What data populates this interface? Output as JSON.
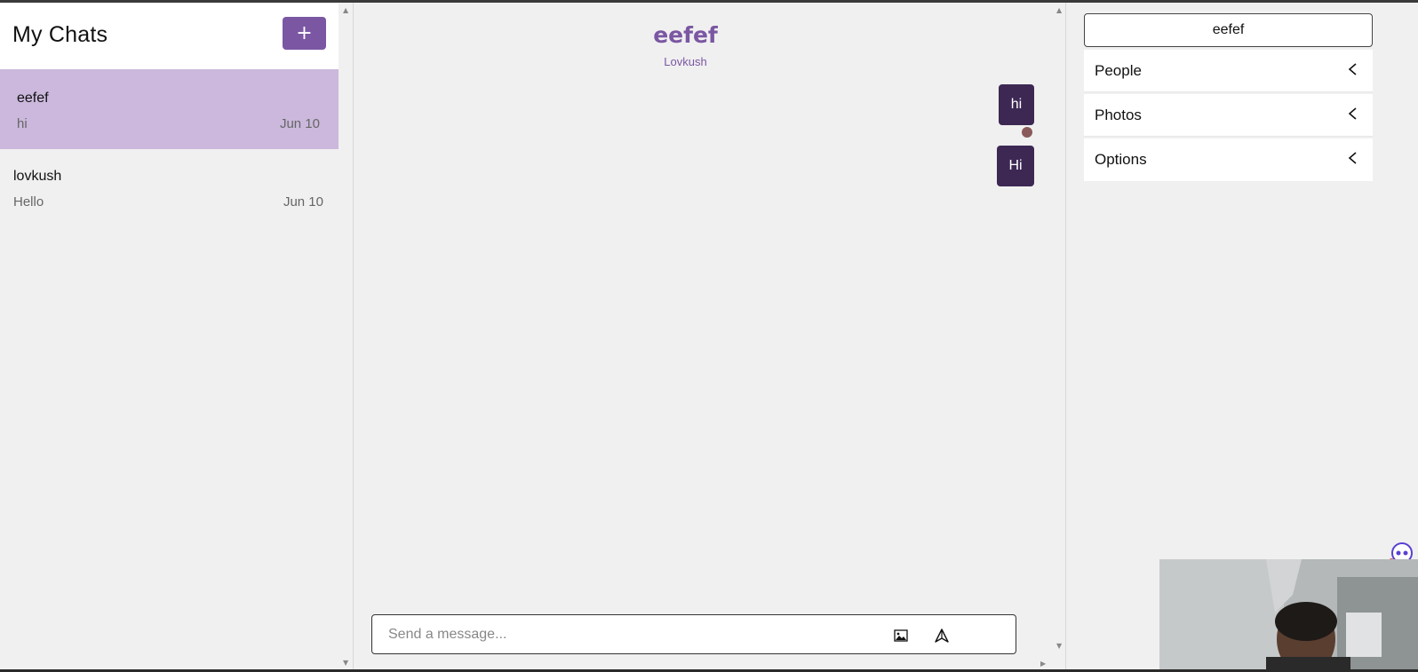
{
  "sidebar": {
    "title": "My Chats",
    "add_label": "+",
    "chats": [
      {
        "name": "eefef",
        "last_message": "hi",
        "date": "Jun 10",
        "active": true
      },
      {
        "name": "lovkush",
        "last_message": "Hello",
        "date": "Jun 10",
        "active": false
      }
    ]
  },
  "conversation": {
    "title": "eefef",
    "subtitle": "Lovkush",
    "messages": [
      {
        "text": "hi"
      },
      {
        "text": "Hi"
      }
    ],
    "input_placeholder": "Send a message..."
  },
  "details": {
    "name": "eefef",
    "sections": [
      {
        "label": "People"
      },
      {
        "label": "Photos"
      },
      {
        "label": "Options"
      }
    ]
  },
  "colors": {
    "accent": "#7b57a3",
    "active_chat_bg": "#cbb8dc",
    "bubble_bg": "#3d2854"
  },
  "icons": {
    "image": "image-icon",
    "send": "send-icon",
    "chevron": "chevron-left-icon"
  }
}
